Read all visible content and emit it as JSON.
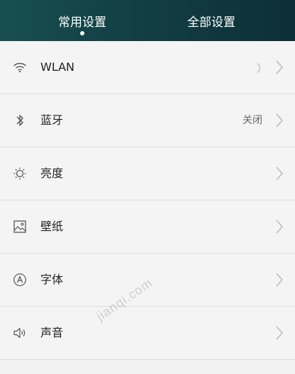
{
  "header": {
    "tabs": [
      {
        "label": "常用设置",
        "active": true
      },
      {
        "label": "全部设置",
        "active": false
      }
    ],
    "active_indicator_color": "#ffffff",
    "background_colors": [
      "#184f4f",
      "#0d2f37"
    ]
  },
  "settings": [
    {
      "icon": "wifi-icon",
      "label": "WLAN",
      "status": "",
      "loading": true
    },
    {
      "icon": "bluetooth-icon",
      "label": "蓝牙",
      "status": "关闭",
      "loading": false
    },
    {
      "icon": "brightness-icon",
      "label": "亮度",
      "status": "",
      "loading": false
    },
    {
      "icon": "wallpaper-icon",
      "label": "壁纸",
      "status": "",
      "loading": false
    },
    {
      "icon": "font-icon",
      "label": "字体",
      "status": "",
      "loading": false
    },
    {
      "icon": "sound-icon",
      "label": "声音",
      "status": "",
      "loading": false
    }
  ],
  "watermark": "jianqi.com"
}
